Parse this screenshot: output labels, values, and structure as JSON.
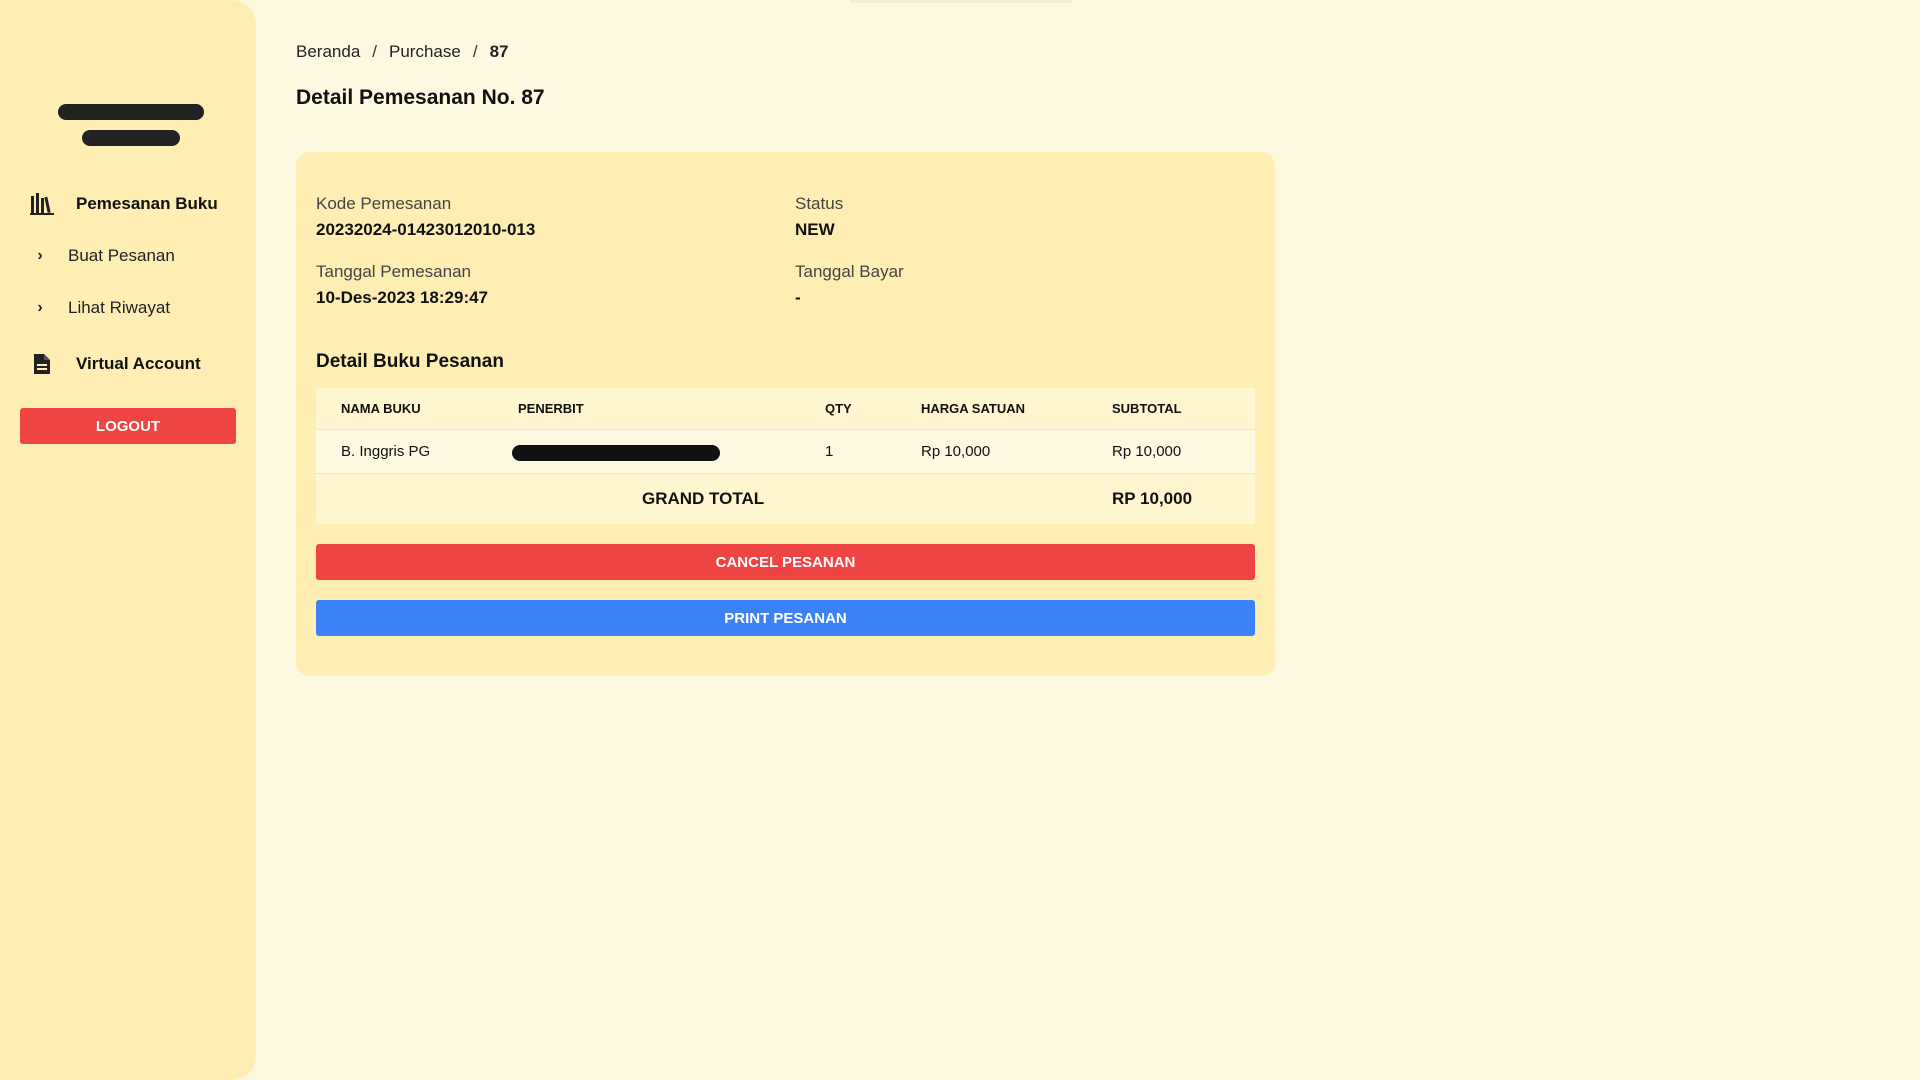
{
  "sidebar": {
    "sections": [
      {
        "label": "Pemesanan Buku",
        "icon": "books-icon"
      },
      {
        "label": "Virtual Account",
        "icon": "document-icon"
      }
    ],
    "sub_items": [
      {
        "label": "Buat Pesanan",
        "icon": "chevron-right-icon"
      },
      {
        "label": "Lihat Riwayat",
        "icon": "chevron-right-icon"
      }
    ],
    "logout_label": "LOGOUT"
  },
  "breadcrumb": {
    "items": [
      "Beranda",
      "Purchase",
      "87"
    ],
    "separator": "/"
  },
  "page_title": "Detail Pemesanan No. 87",
  "order": {
    "kode_label": "Kode Pemesanan",
    "kode_value": "20232024-01423012010-013",
    "status_label": "Status",
    "status_value": "NEW",
    "tanggal_label": "Tanggal Pemesanan",
    "tanggal_value": "10-Des-2023 18:29:47",
    "bayar_label": "Tanggal Bayar",
    "bayar_value": "-"
  },
  "books_section_title": "Detail Buku Pesanan",
  "table": {
    "headers": [
      "NAMA BUKU",
      "PENERBIT",
      "QTY",
      "HARGA SATUAN",
      "SUBTOTAL"
    ],
    "rows": [
      {
        "nama_buku": "B. Inggris PG",
        "penerbit": "",
        "qty": "1",
        "harga": "Rp 10,000",
        "subtotal": "Rp 10,000"
      }
    ],
    "grand_total_label": "GRAND TOTAL",
    "grand_total_value": "RP 10,000"
  },
  "actions": {
    "cancel_label": "CANCEL PESANAN",
    "print_label": "PRINT PESANAN"
  },
  "colors": {
    "sidebar_bg": "#feeeb3",
    "page_bg": "#fdf9e1",
    "danger": "#ef4444",
    "primary": "#3b82f6"
  }
}
